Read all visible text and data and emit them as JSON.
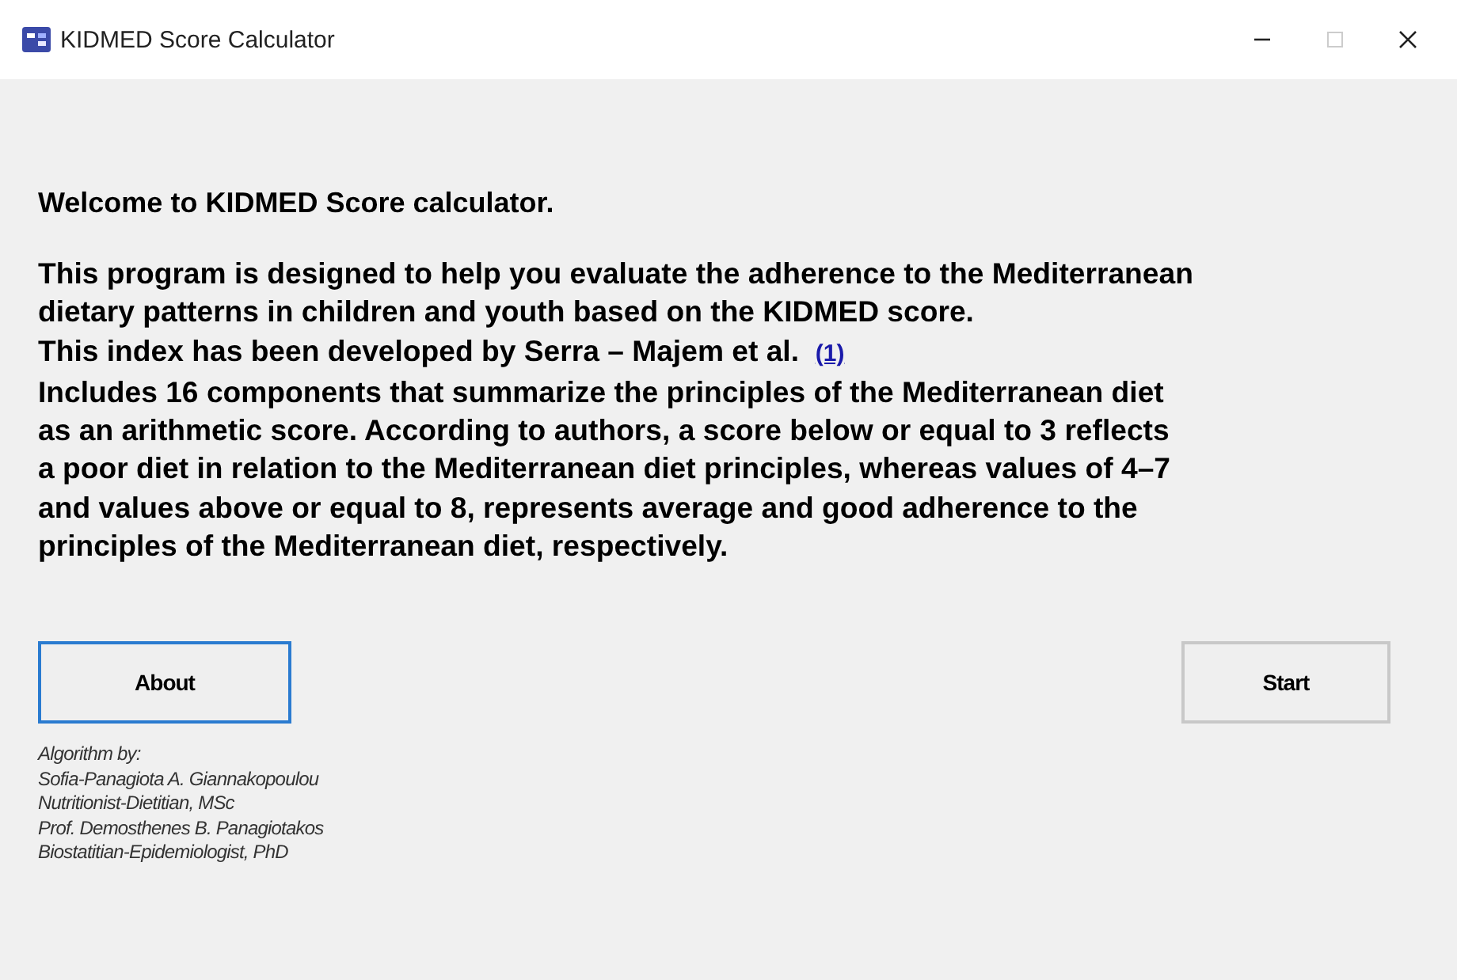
{
  "window": {
    "title": "KIDMED Score Calculator",
    "controls": [
      {
        "kind": "minimize",
        "disabled": false
      },
      {
        "kind": "maximize",
        "disabled": true
      },
      {
        "kind": "close",
        "disabled": false
      }
    ]
  },
  "heading": "Welcome to KIDMED Score calculator.",
  "description": {
    "lines_before": [
      "This program is designed to help you evaluate the adherence to the Mediterranean",
      "dietary patterns in children and youth based on the KIDMED score."
    ],
    "link_line": "This index has been developed by Serra – Majem et al.",
    "link": "(1)",
    "lines_after": [
      "Includes 16 components that summarize the principles of the Mediterranean diet",
      "as an arithmetic score. According to authors, a score below or equal to 3 reflects",
      "a poor diet in relation  to the Mediterranean diet principles, whereas values of 4–7",
      "and values above or equal to 8, represents average and good adherence to the",
      "principles of the Mediterranean diet, respectively."
    ]
  },
  "buttons": [
    {
      "label": "About",
      "focused": true
    },
    {
      "label": "Start",
      "focused": false
    }
  ],
  "credits": [
    "Algorithm by:",
    "Sofia-Panagiota A. Giannakopoulou",
    "Nutritionist-Dietitian, MSc",
    "Prof. Demosthenes B. Panagiotakos",
    "Biostatitian-Epidemiologist, PhD"
  ]
}
